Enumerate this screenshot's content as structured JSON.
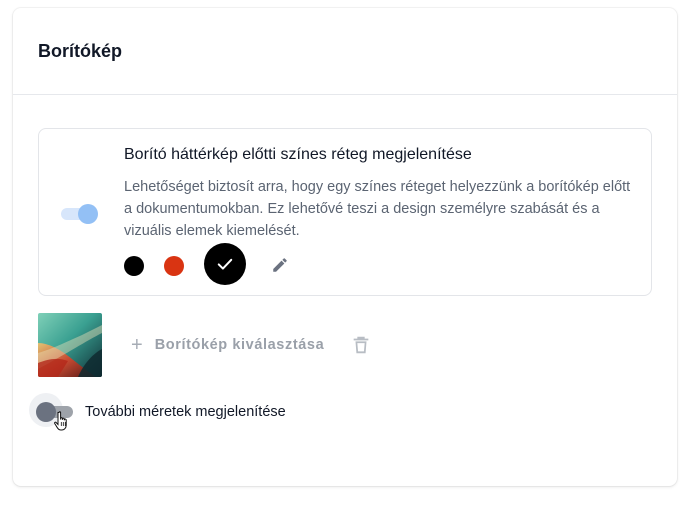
{
  "card": {
    "title": "Borítókép"
  },
  "overlay": {
    "enabled": true,
    "title": "Borító háttérkép előtti színes réteg megjelenítése",
    "description": "Lehetőséget biztosít arra, hogy egy színes réteget helyezzünk a borítókép előtt a dokumentumokban. Ez lehetővé teszi a design személyre szabását és a vizuális elemek kiemelését.",
    "colors": [
      {
        "name": "black",
        "hex": "#000000",
        "selected": false
      },
      {
        "name": "red",
        "hex": "#d93412",
        "selected": false
      },
      {
        "name": "black",
        "hex": "#000000",
        "selected": true
      }
    ],
    "edit_icon": "pencil-icon"
  },
  "cover": {
    "thumbnail_icon": "abstract-painting-image",
    "select_icon": "plus-icon",
    "select_label": "Borítókép kiválasztása",
    "delete_icon": "trash-icon"
  },
  "more_sizes": {
    "enabled": false,
    "label": "További méretek megjelenítése"
  }
}
